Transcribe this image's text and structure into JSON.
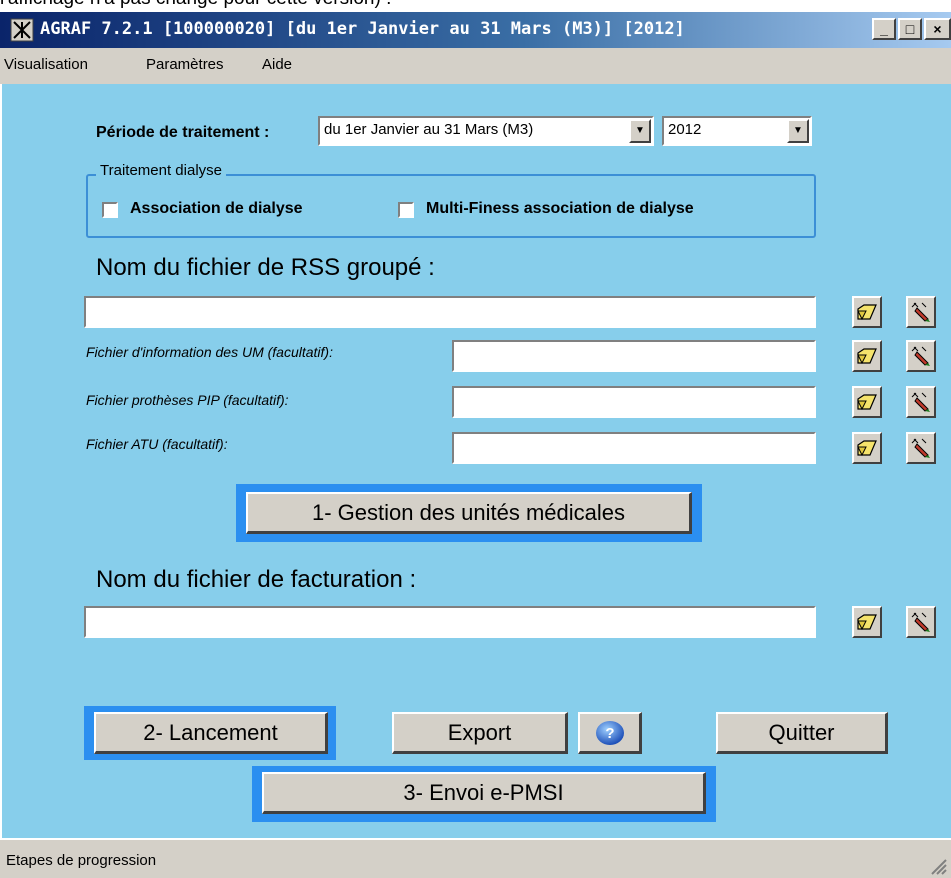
{
  "top_caption": "l'affichage n'a pas changé pour cette version) :",
  "window": {
    "title": "AGRAF 7.2.1 [100000020] [du 1er Janvier au 31 Mars (M3)] [2012]",
    "controls": {
      "minimize": "_",
      "maximize": "□",
      "close": "×"
    }
  },
  "menu": [
    "Visualisation",
    "Paramètres",
    "Aide"
  ],
  "period": {
    "label": "Période de traitement :",
    "period_value": "du 1er Janvier au 31 Mars (M3)",
    "year_value": "2012"
  },
  "dialysis": {
    "group_title": "Traitement dialyse",
    "association_label": "Association de dialyse",
    "multi_finess_label": "Multi-Finess association de dialyse"
  },
  "rss": {
    "heading": "Nom du fichier de RSS groupé :",
    "value": "",
    "um_label": "Fichier d'information des UM (facultatif):",
    "um_value": "",
    "pip_label": "Fichier prothèses PIP (facultatif):",
    "pip_value": "",
    "atu_label": "Fichier ATU (facultatif):",
    "atu_value": ""
  },
  "buttons": {
    "gestion": "1- Gestion des unités médicales",
    "lancement": "2- Lancement",
    "export": "Export",
    "help": "?",
    "quitter": "Quitter",
    "envoi": "3- Envoi e-PMSI"
  },
  "billing": {
    "heading": "Nom du fichier de facturation :",
    "value": ""
  },
  "status": {
    "text": "Etapes de progression"
  },
  "colors": {
    "client_bg": "#87ceeb",
    "highlight": "#2b8ff0",
    "titlebar": "#0a246a"
  },
  "icons": [
    "open-folder-icon",
    "edit-pencil-icon",
    "help-icon",
    "app-icon"
  ]
}
